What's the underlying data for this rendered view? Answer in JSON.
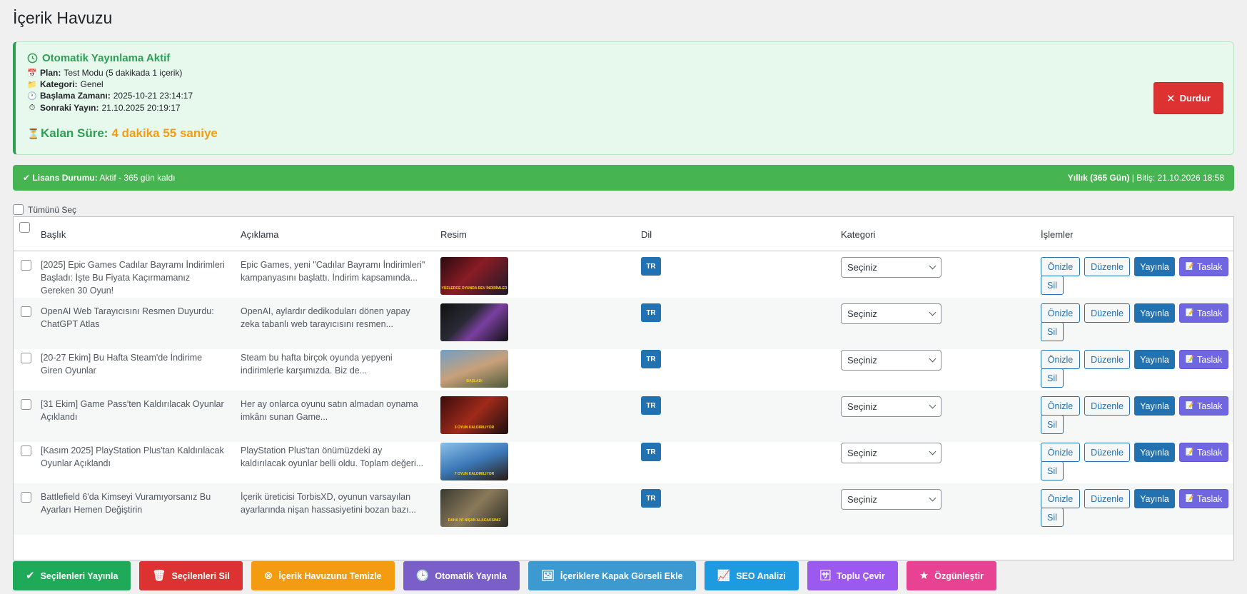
{
  "page": {
    "title": "İçerik Havuzu"
  },
  "auto_publish": {
    "title": "Otomatik Yayınlama Aktif",
    "plan_label": "Plan:",
    "plan_value": "Test Modu (5 dakikada 1 içerik)",
    "category_label": "Kategori:",
    "category_value": "Genel",
    "start_label": "Başlama Zamanı:",
    "start_value": "2025-10-21 23:14:17",
    "next_label": "Sonraki Yayın:",
    "next_value": "21.10.2025 20:19:17",
    "remaining_label": "Kalan Süre:",
    "remaining_value": "4 dakika 55 saniye",
    "stop_label": "Durdur"
  },
  "license": {
    "status_label": "Lisans Durumu:",
    "status_value": "Aktif - 365 gün kaldı",
    "plan_label": "Yıllık (365 Gün)",
    "expiry_text": "| Bitiş: 21.10.2026 18:58"
  },
  "select_all_label": "Tümünü Seç",
  "columns": [
    "Başlık",
    "Açıklama",
    "Resim",
    "Dil",
    "Kategori",
    "İşlemler"
  ],
  "actions": {
    "preview": "Önizle",
    "edit": "Düzenle",
    "publish": "Yayınla",
    "draft": "Taslak",
    "delete": "Sil"
  },
  "rows": [
    {
      "title": "[2025] Epic Games Cadılar Bayramı İndirimleri Başladı: İşte Bu Fiyata Kaçırmamanız Gereken 30 Oyun!",
      "description": "Epic Games, yeni \"Cadılar Bayramı İndirimleri\" kampanyasını başlattı. İndirim kapsamında...",
      "thumb_caption": "YÜZLERCE OYUNDA DEV İNDİRİMLER",
      "lang": "TR",
      "category": "Seçiniz"
    },
    {
      "title": "OpenAI Web Tarayıcısını Resmen Duyurdu: ChatGPT Atlas",
      "description": "OpenAI, aylardır dedikoduları dönen yapay zeka tabanlı web tarayıcısını resmen...",
      "thumb_caption": "",
      "lang": "TR",
      "category": "Seçiniz"
    },
    {
      "title": "[20-27 Ekim] Bu Hafta Steam'de İndirime Giren Oyunlar",
      "description": "Steam bu hafta birçok oyunda yepyeni indirimlerle karşımızda. Biz de...",
      "thumb_caption": "BAŞLADI",
      "lang": "TR",
      "category": "Seçiniz"
    },
    {
      "title": "[31 Ekim] Game Pass'ten Kaldırılacak Oyunlar Açıklandı",
      "description": "Her ay onlarca oyunu satın almadan oynama imkânı sunan Game...",
      "thumb_caption": "3 OYUN KALDIRILIYOR",
      "lang": "TR",
      "category": "Seçiniz"
    },
    {
      "title": "[Kasım 2025] PlayStation Plus'tan Kaldırılacak Oyunlar Açıklandı",
      "description": "PlayStation Plus'tan önümüzdeki ay kaldırılacak oyunlar belli oldu. Toplam değeri...",
      "thumb_caption": "7 OYUN KALDIRILIYOR",
      "lang": "TR",
      "category": "Seçiniz"
    },
    {
      "title": "Battlefield 6'da Kimseyi Vuramıyorsanız Bu Ayarları Hemen Değiştirin",
      "description": "İçerik üreticisi TorbisXD, oyunun varsayılan ayarlarında nişan hassasiyetini bozan bazı...",
      "thumb_caption": "DAHA İYİ NİŞAN ALACAKSINIZ",
      "lang": "TR",
      "category": "Seçiniz"
    }
  ],
  "bottom_actions": [
    {
      "label": "Seçilenleri Yayınla",
      "icon": "check-circle-icon",
      "color": "#1faa59"
    },
    {
      "label": "Seçilenleri Sil",
      "icon": "trash-icon",
      "color": "#dc3232"
    },
    {
      "label": "İçerik Havuzunu Temizle",
      "icon": "x-circle-icon",
      "color": "#f39c12"
    },
    {
      "label": "Otomatik Yayınla",
      "icon": "clock-icon",
      "color": "#7a5fc9"
    },
    {
      "label": "İçeriklere Kapak Görseli Ekle",
      "icon": "image-icon",
      "color": "#3d9ad1"
    },
    {
      "label": "SEO Analizi",
      "icon": "chart-icon",
      "color": "#1e9be0"
    },
    {
      "label": "Toplu Çevir",
      "icon": "translate-icon",
      "color": "#9b59f0"
    },
    {
      "label": "Özgünleştir",
      "icon": "star-icon",
      "color": "#e84393"
    }
  ]
}
